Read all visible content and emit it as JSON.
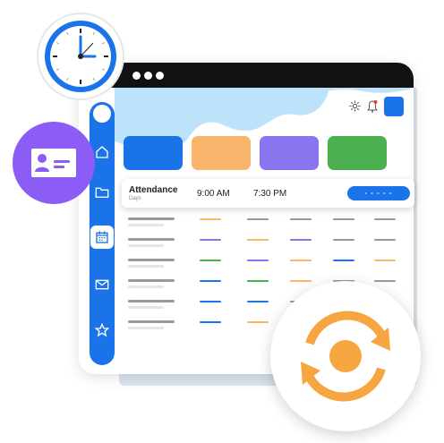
{
  "colors": {
    "blue": "#1a73e8",
    "orange": "#f8b56b",
    "purple": "#8b74f0",
    "green": "#4caf50",
    "grey": "#999999",
    "sky": "#bde3fb"
  },
  "header": {
    "icons": [
      "gear-icon",
      "bell-icon",
      "profile-square-icon"
    ]
  },
  "sidebar": {
    "items": [
      "home-icon",
      "folder-icon",
      "calendar-icon",
      "mail-icon",
      "star-icon"
    ],
    "active": "calendar-icon"
  },
  "cards": [
    "blue",
    "orange",
    "purple",
    "green"
  ],
  "attendance": {
    "title": "Attendance",
    "subtitle": "Days",
    "in_time": "9:00 AM",
    "out_time": "7:30 PM",
    "button_label": "- - - - -"
  },
  "table": {
    "rows": [
      [
        "orange",
        "grey",
        "grey",
        "grey",
        "grey"
      ],
      [
        "purple",
        "orange",
        "purple",
        "grey",
        "grey"
      ],
      [
        "green",
        "purple",
        "orange",
        "blue",
        "orange"
      ],
      [
        "blue",
        "green",
        "orange",
        "grey",
        "grey"
      ],
      [
        "blue",
        "blue",
        "grey",
        "grey",
        "grey"
      ],
      [
        "blue",
        "orange",
        "grey",
        "grey",
        "grey"
      ]
    ]
  },
  "illustrations": [
    "clock-icon",
    "id-card-icon",
    "sync-icon"
  ]
}
